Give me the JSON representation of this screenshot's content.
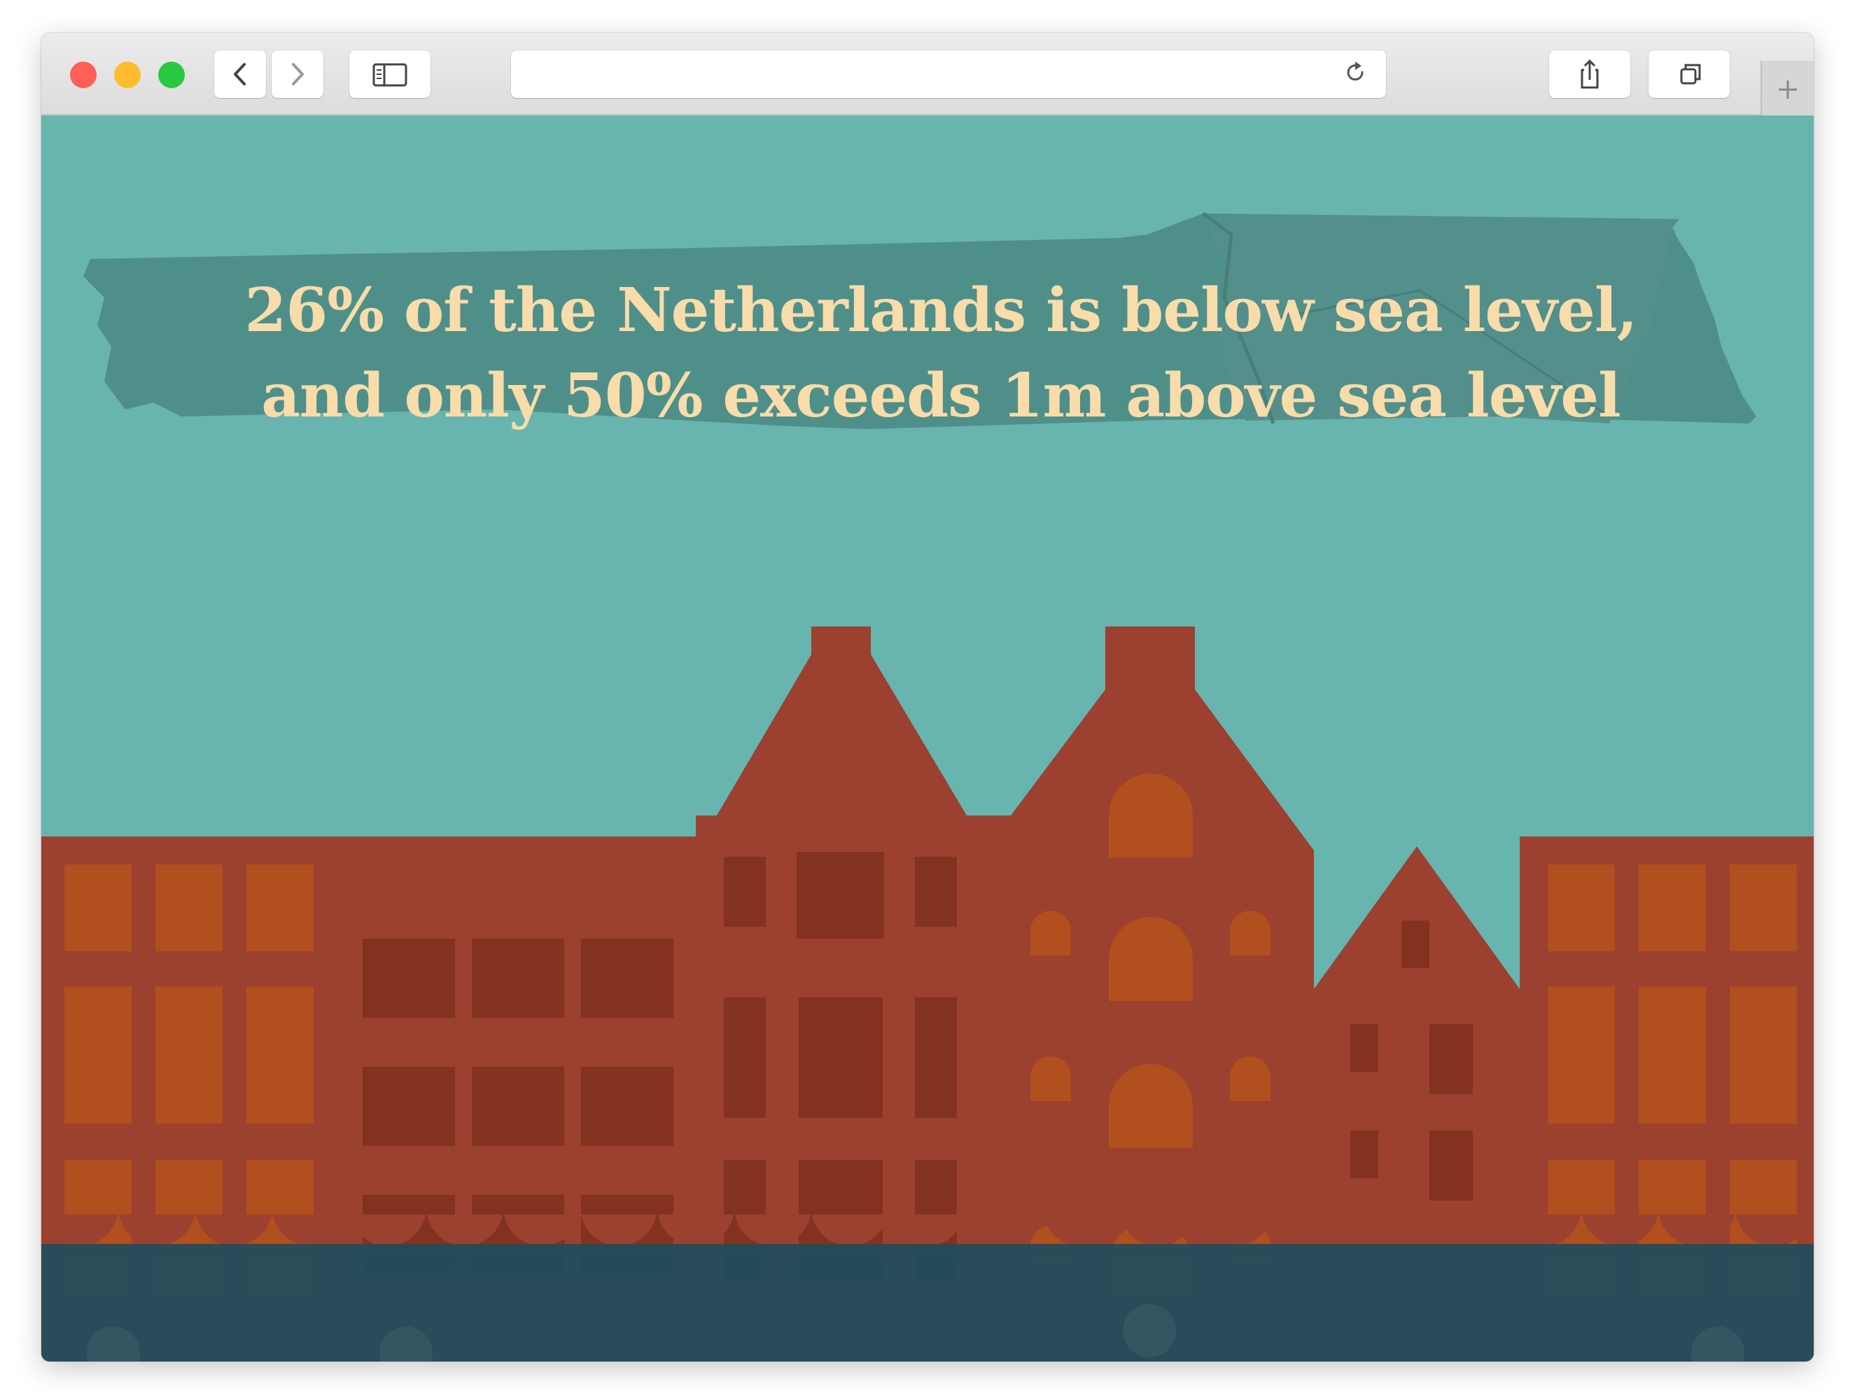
{
  "browser": {
    "address": "",
    "controls": {
      "close_color": "#fe5f57",
      "minimize_color": "#febc2e",
      "maximize_color": "#28c840"
    },
    "icons": [
      "chevron-left-icon",
      "chevron-right-icon",
      "sidebar-icon",
      "reload-icon",
      "share-icon",
      "tabs-overview-icon",
      "plus-icon"
    ]
  },
  "page": {
    "headline_line1": "26% of the Netherlands is below sea level,",
    "headline_line2": "and only 50% exceeds 1m above sea level"
  },
  "colors": {
    "sky": "#68b4ae",
    "tape": "#4f8f8a",
    "brick": "#9c4030",
    "window_orange": "#b14f1e",
    "window_dark": "#843220",
    "water": "#1f4e5c",
    "text": "#f8dcaa"
  }
}
